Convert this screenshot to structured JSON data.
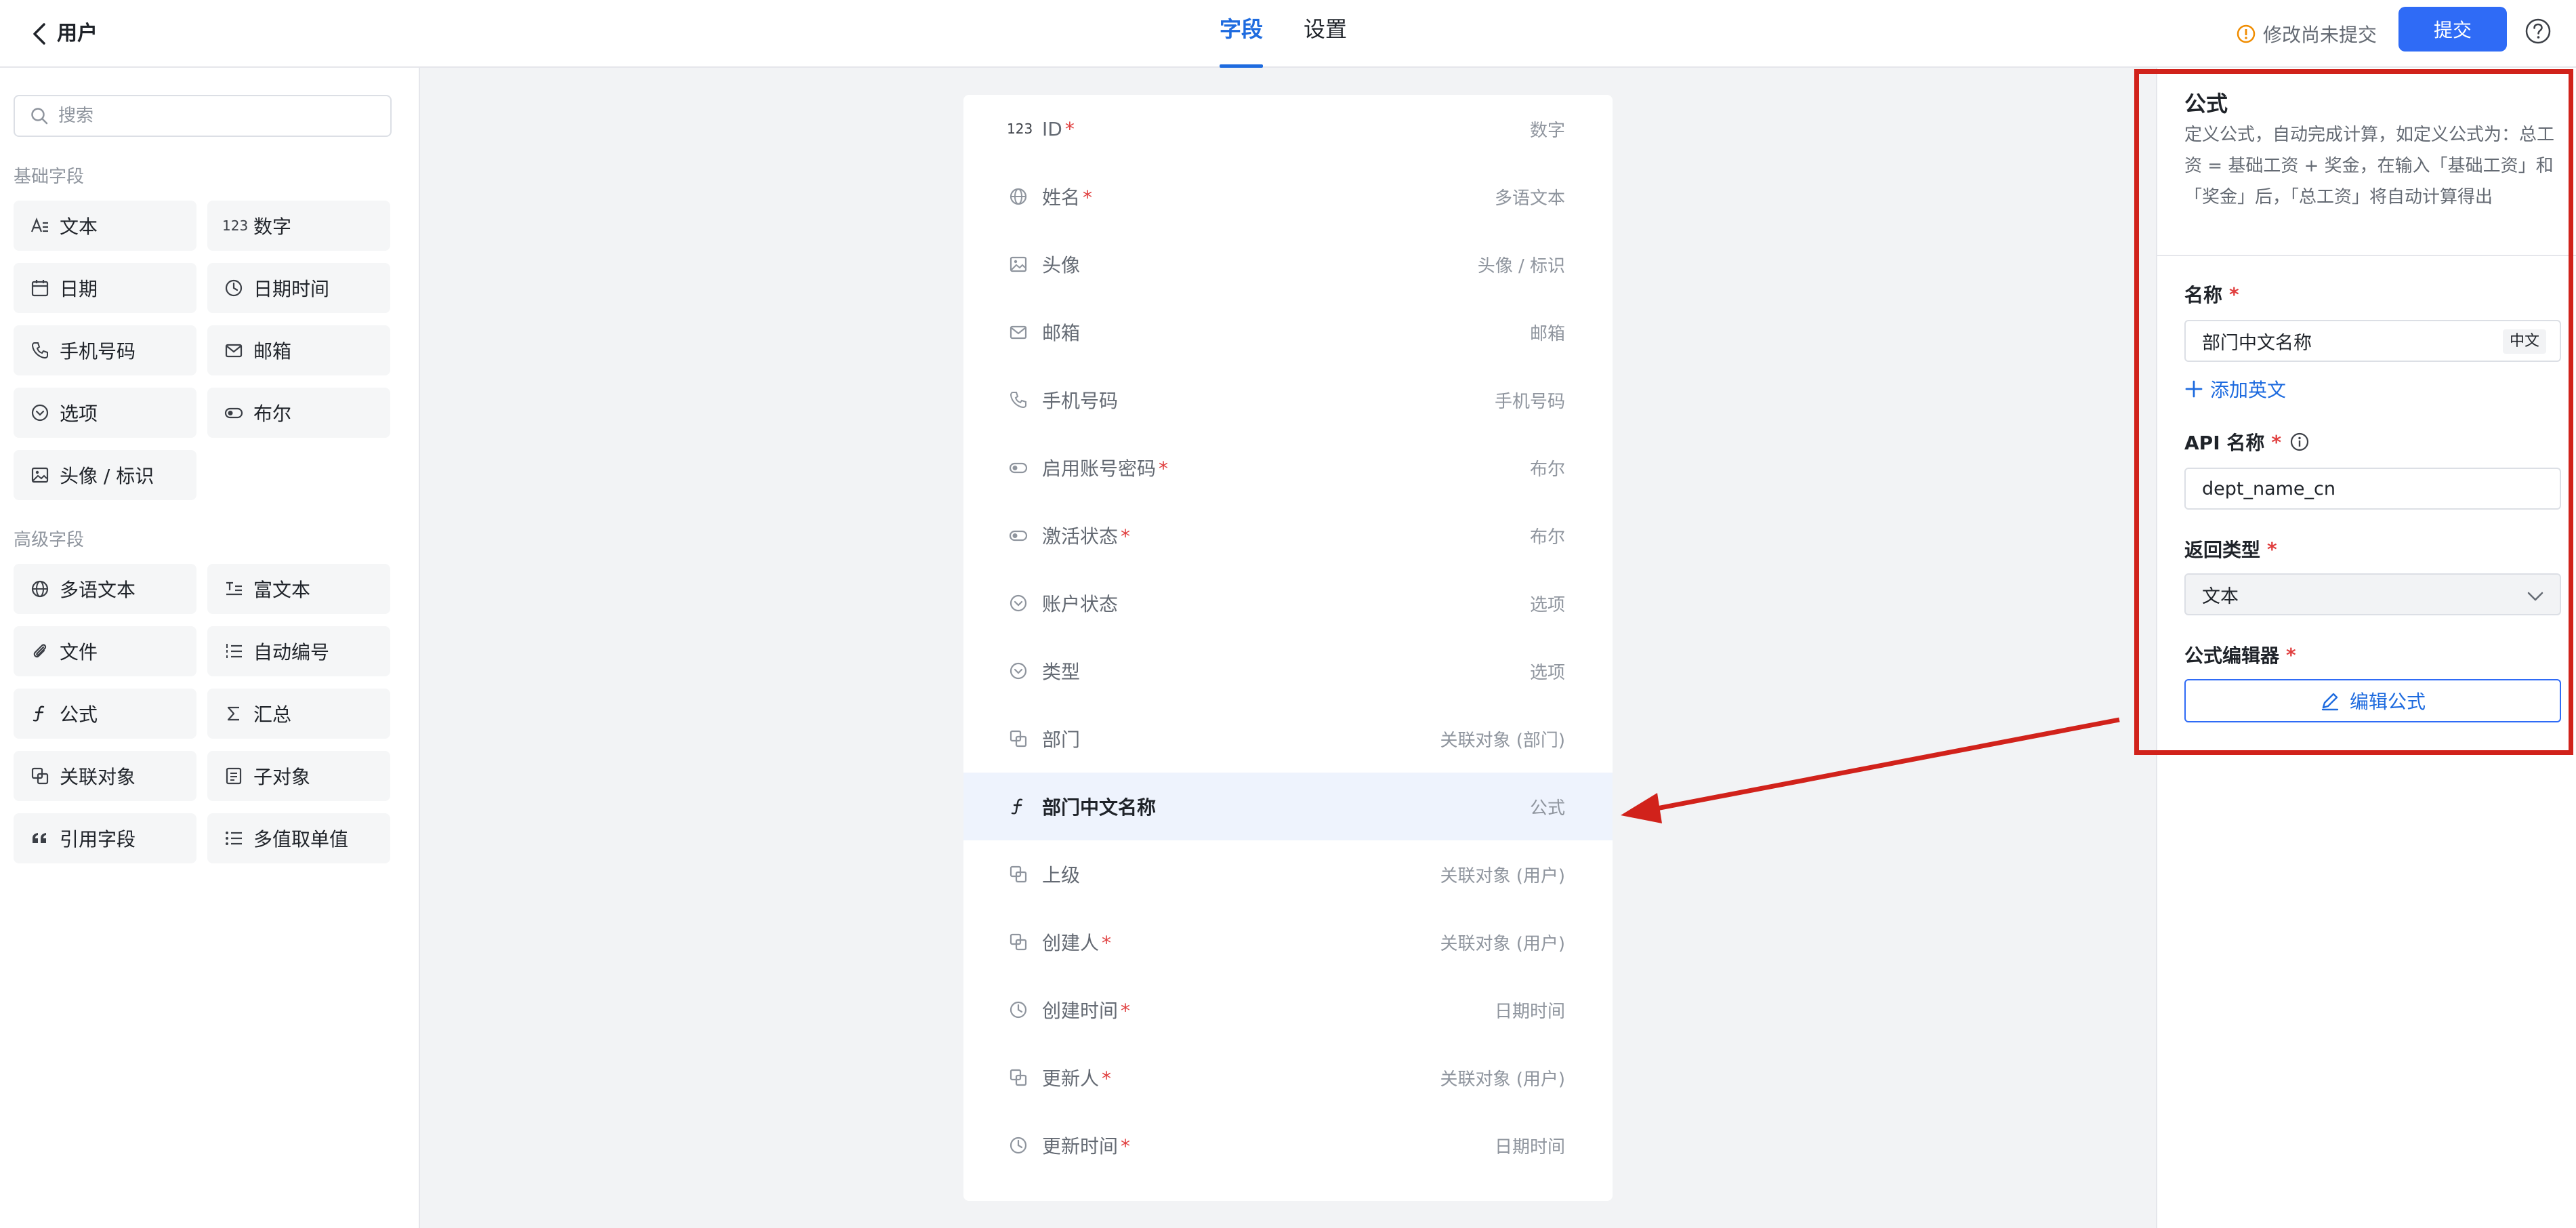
{
  "header": {
    "title": "用户",
    "tabs": [
      {
        "label": "字段",
        "active": true
      },
      {
        "label": "设置",
        "active": false
      }
    ],
    "unsaved_text": "修改尚未提交",
    "submit_label": "提交"
  },
  "left_panel": {
    "search_placeholder": "搜索",
    "groups": [
      {
        "title": "基础字段",
        "items": [
          {
            "label": "文本",
            "icon": "text-icon"
          },
          {
            "label": "数字",
            "icon": "number-icon"
          },
          {
            "label": "日期",
            "icon": "calendar-icon"
          },
          {
            "label": "日期时间",
            "icon": "clock-icon"
          },
          {
            "label": "手机号码",
            "icon": "phone-icon"
          },
          {
            "label": "邮箱",
            "icon": "mail-icon"
          },
          {
            "label": "选项",
            "icon": "option-icon"
          },
          {
            "label": "布尔",
            "icon": "toggle-icon"
          },
          {
            "label": "头像 / 标识",
            "icon": "image-icon"
          }
        ]
      },
      {
        "title": "高级字段",
        "items": [
          {
            "label": "多语文本",
            "icon": "globe-icon"
          },
          {
            "label": "富文本",
            "icon": "richtext-icon"
          },
          {
            "label": "文件",
            "icon": "paperclip-icon"
          },
          {
            "label": "自动编号",
            "icon": "numbered-list-icon"
          },
          {
            "label": "公式",
            "icon": "formula-icon"
          },
          {
            "label": "汇总",
            "icon": "sigma-icon"
          },
          {
            "label": "关联对象",
            "icon": "link-object-icon"
          },
          {
            "label": "子对象",
            "icon": "sub-object-icon"
          },
          {
            "label": "引用字段",
            "icon": "quote-icon"
          },
          {
            "label": "多值取单值",
            "icon": "multi-list-icon"
          }
        ]
      }
    ]
  },
  "fields": [
    {
      "label": "ID",
      "required": true,
      "type": "数字",
      "icon": "number-icon"
    },
    {
      "label": "姓名",
      "required": true,
      "type": "多语文本",
      "icon": "globe-icon"
    },
    {
      "label": "头像",
      "required": false,
      "type": "头像 / 标识",
      "icon": "image-icon"
    },
    {
      "label": "邮箱",
      "required": false,
      "type": "邮箱",
      "icon": "mail-icon"
    },
    {
      "label": "手机号码",
      "required": false,
      "type": "手机号码",
      "icon": "phone-icon"
    },
    {
      "label": "启用账号密码",
      "required": true,
      "type": "布尔",
      "icon": "toggle-icon"
    },
    {
      "label": "激活状态",
      "required": true,
      "type": "布尔",
      "icon": "toggle-icon"
    },
    {
      "label": "账户状态",
      "required": false,
      "type": "选项",
      "icon": "option-icon"
    },
    {
      "label": "类型",
      "required": false,
      "type": "选项",
      "icon": "option-icon"
    },
    {
      "label": "部门",
      "required": false,
      "type": "关联对象 (部门)",
      "icon": "link-object-icon"
    },
    {
      "label": "部门中文名称",
      "required": false,
      "type": "公式",
      "icon": "formula-icon",
      "selected": true
    },
    {
      "label": "上级",
      "required": false,
      "type": "关联对象 (用户)",
      "icon": "link-object-icon"
    },
    {
      "label": "创建人",
      "required": true,
      "type": "关联对象 (用户)",
      "icon": "link-object-icon"
    },
    {
      "label": "创建时间",
      "required": true,
      "type": "日期时间",
      "icon": "clock-icon"
    },
    {
      "label": "更新人",
      "required": true,
      "type": "关联对象 (用户)",
      "icon": "link-object-icon"
    },
    {
      "label": "更新时间",
      "required": true,
      "type": "日期时间",
      "icon": "clock-icon"
    }
  ],
  "props": {
    "title": "公式",
    "description": "定义公式，自动完成计算，如定义公式为：总工资 = 基础工资 + 奖金，在输入「基础工资」和「奖金」后，「总工资」将自动计算得出",
    "name_label": "名称",
    "name_value": "部门中文名称",
    "name_lang": "中文",
    "add_english": "添加英文",
    "api_label": "API 名称",
    "api_value": "dept_name_cn",
    "return_label": "返回类型",
    "return_value": "文本",
    "editor_label": "公式编辑器",
    "edit_button": "编辑公式",
    "required_mark": "*"
  },
  "colors": {
    "accent": "#1e6bdf",
    "primary_button": "#2f6bf6",
    "warning": "#f08c00",
    "required": "#e03e3e",
    "annotation": "#d1221b",
    "selected_row": "#eef3fd"
  }
}
